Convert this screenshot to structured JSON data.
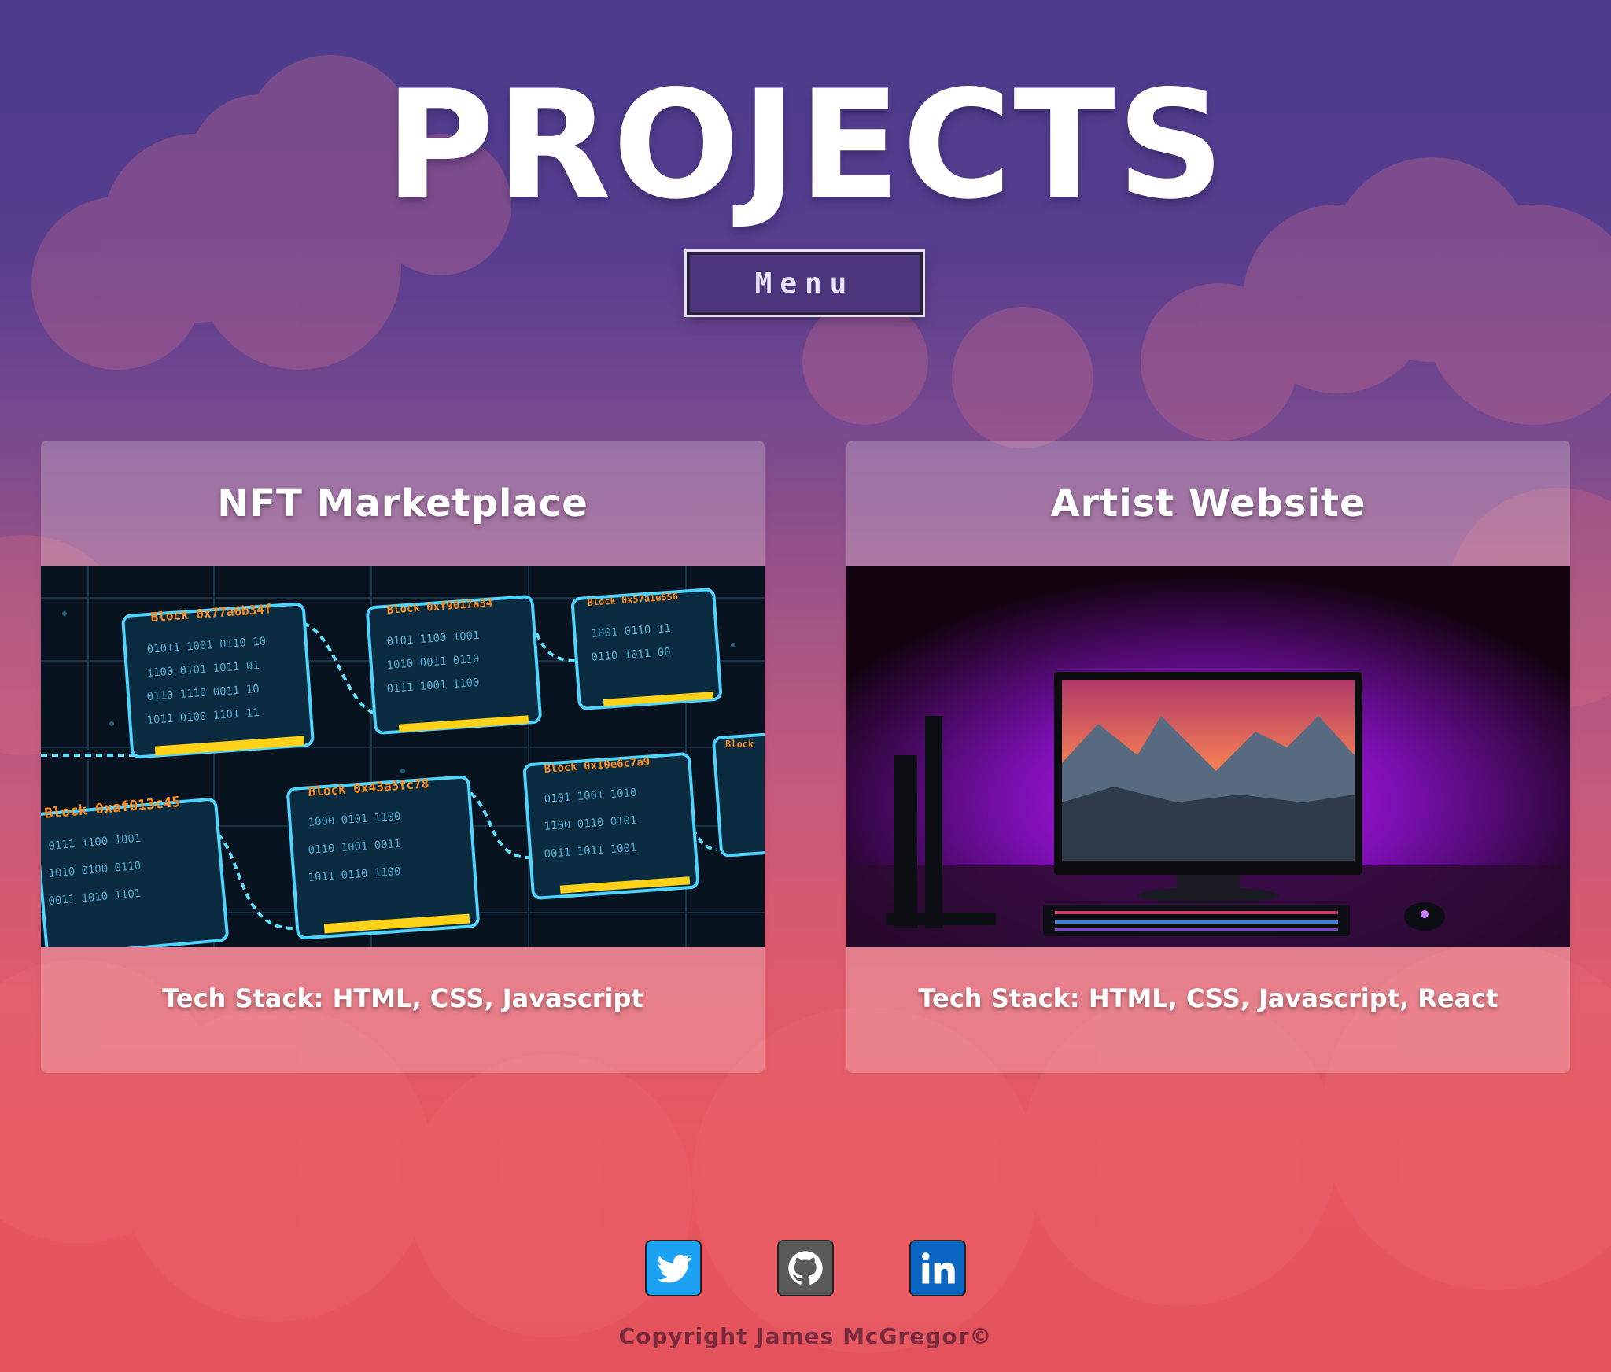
{
  "page": {
    "title": "PROJECTS",
    "menu_label": "Menu"
  },
  "projects": [
    {
      "title": "NFT Marketplace",
      "tech_stack": "Tech Stack: HTML, CSS, Javascript",
      "image": "blockchain-blocks-illustration"
    },
    {
      "title": "Artist Website",
      "tech_stack": "Tech Stack: HTML, CSS, Javascript, React",
      "image": "purple-lit-desktop-monitor-photo"
    }
  ],
  "footer": {
    "social": [
      {
        "name": "twitter-icon"
      },
      {
        "name": "github-icon"
      },
      {
        "name": "linkedin-icon"
      }
    ],
    "copyright": "Copyright James McGregor©"
  },
  "colors": {
    "background_top": "#4b3b8c",
    "background_bottom": "#e4525c",
    "menu_bg": "#4d357c",
    "copyright_text": "#7a2a3d"
  },
  "nft_image_labels": [
    "Block 0x77a6b34f",
    "Block 0xf9017a34",
    "Block 0x57a1e556",
    "Block 0xaf013c45",
    "Block 0x43a5fc78",
    "Block 0x10e6c7a9",
    "Block"
  ]
}
